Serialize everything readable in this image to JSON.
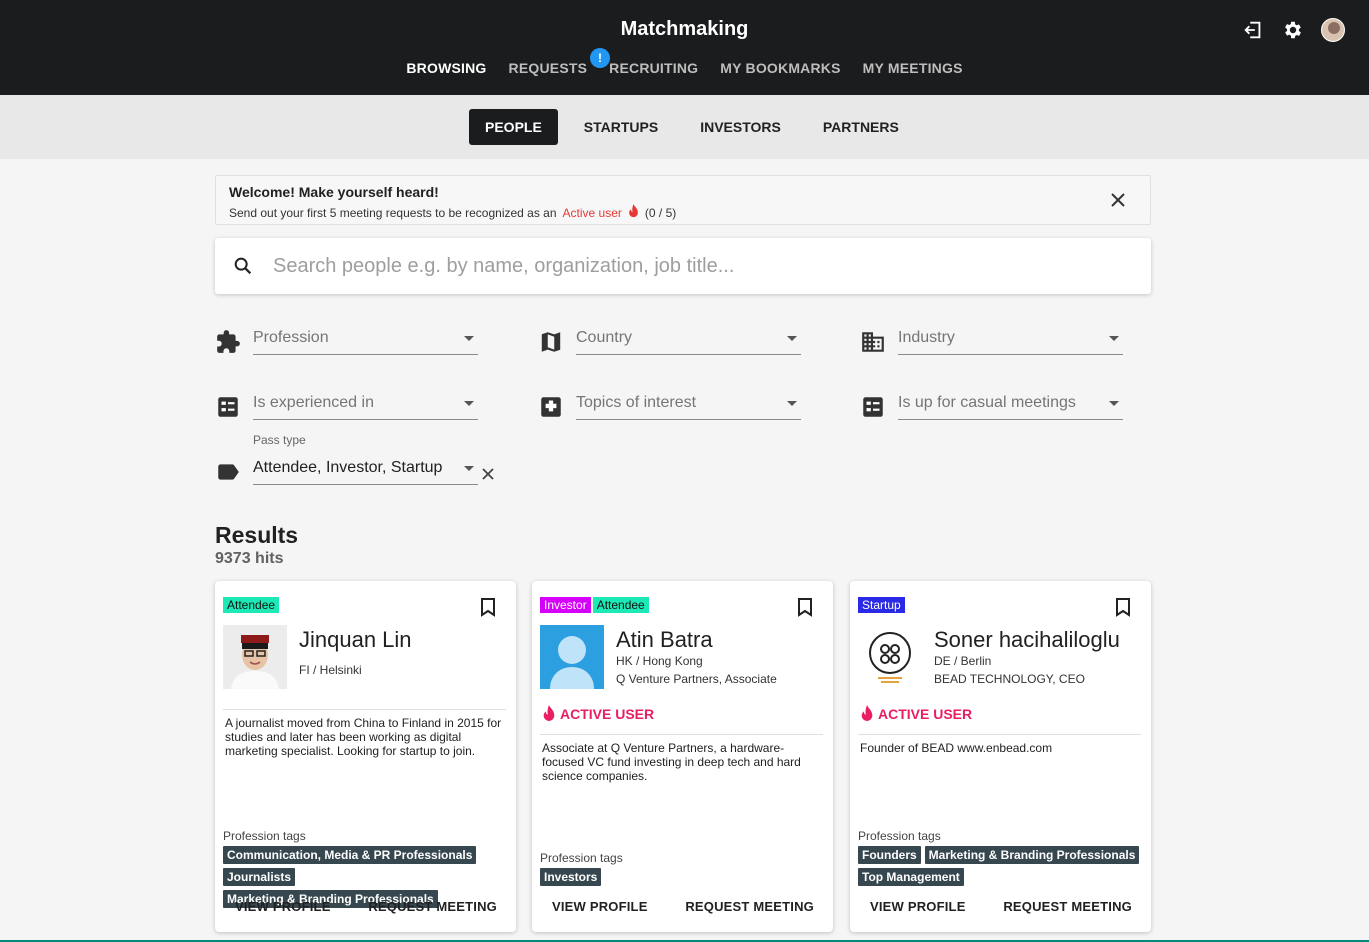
{
  "app": {
    "title": "Matchmaking"
  },
  "nav": {
    "items": [
      "BROWSING",
      "REQUESTS",
      "RECRUITING",
      "MY BOOKMARKS",
      "MY MEETINGS"
    ],
    "active": "BROWSING",
    "requests_badge": "!"
  },
  "header_icons": [
    "logout-icon",
    "settings-icon",
    "avatar"
  ],
  "category_tabs": {
    "items": [
      "PEOPLE",
      "STARTUPS",
      "INVESTORS",
      "PARTNERS"
    ],
    "active": "PEOPLE"
  },
  "banner": {
    "title": "Welcome! Make yourself heard!",
    "text": "Send out your first 5 meeting requests to be recognized as an",
    "highlight": "Active user",
    "progress": "(0 / 5)"
  },
  "search": {
    "placeholder": "Search people e.g. by name, organization, job title..."
  },
  "filters": {
    "profession": "Profession",
    "country": "Country",
    "industry": "Industry",
    "experienced_in": "Is experienced in",
    "topics": "Topics of interest",
    "casual_meetings": "Is up for casual meetings",
    "pass_type_label": "Pass type",
    "pass_type_value": "Attendee, Investor, Startup"
  },
  "results": {
    "title": "Results",
    "count": "9373 hits",
    "active_user_label": "ACTIVE USER",
    "profession_tags_label": "Profession tags",
    "view_profile": "VIEW PROFILE",
    "request_meeting": "REQUEST MEETING",
    "cards": [
      {
        "pass_tags": [
          "Attendee"
        ],
        "name": "Jinquan Lin",
        "location": "FI / Helsinki",
        "organization": "",
        "active_user": false,
        "bio": "A journalist moved from China to Finland in 2015 for studies and later has been working as digital marketing specialist. Looking for startup to join.",
        "profession_tags": [
          "Communication, Media & PR Professionals",
          "Journalists",
          "Marketing & Branding Professionals"
        ]
      },
      {
        "pass_tags": [
          "Investor",
          "Attendee"
        ],
        "name": "Atin Batra",
        "location": "HK / Hong Kong",
        "organization": "Q Venture Partners, Associate",
        "active_user": true,
        "bio": "Associate at Q Venture Partners, a hardware-focused VC fund investing in deep tech and hard science companies.",
        "profession_tags": [
          "Investors"
        ]
      },
      {
        "pass_tags": [
          "Startup"
        ],
        "name": "Soner hacihaliloglu",
        "location": "DE / Berlin",
        "organization": "BEAD TECHNOLOGY, CEO",
        "active_user": true,
        "bio": "Founder of BEAD www.enbead.com",
        "profession_tags": [
          "Founders",
          "Marketing & Branding Professionals",
          "Top Management"
        ]
      }
    ]
  },
  "colors": {
    "header_bg": "#1b1c1e",
    "badge_blue": "#2196f3",
    "active_red": "#e53935",
    "active_user_pink": "#e91e63",
    "tag_attendee": "#1de9b6",
    "tag_investor": "#d500f9",
    "tag_startup": "#2929e6",
    "chip_bg": "#37474f"
  }
}
